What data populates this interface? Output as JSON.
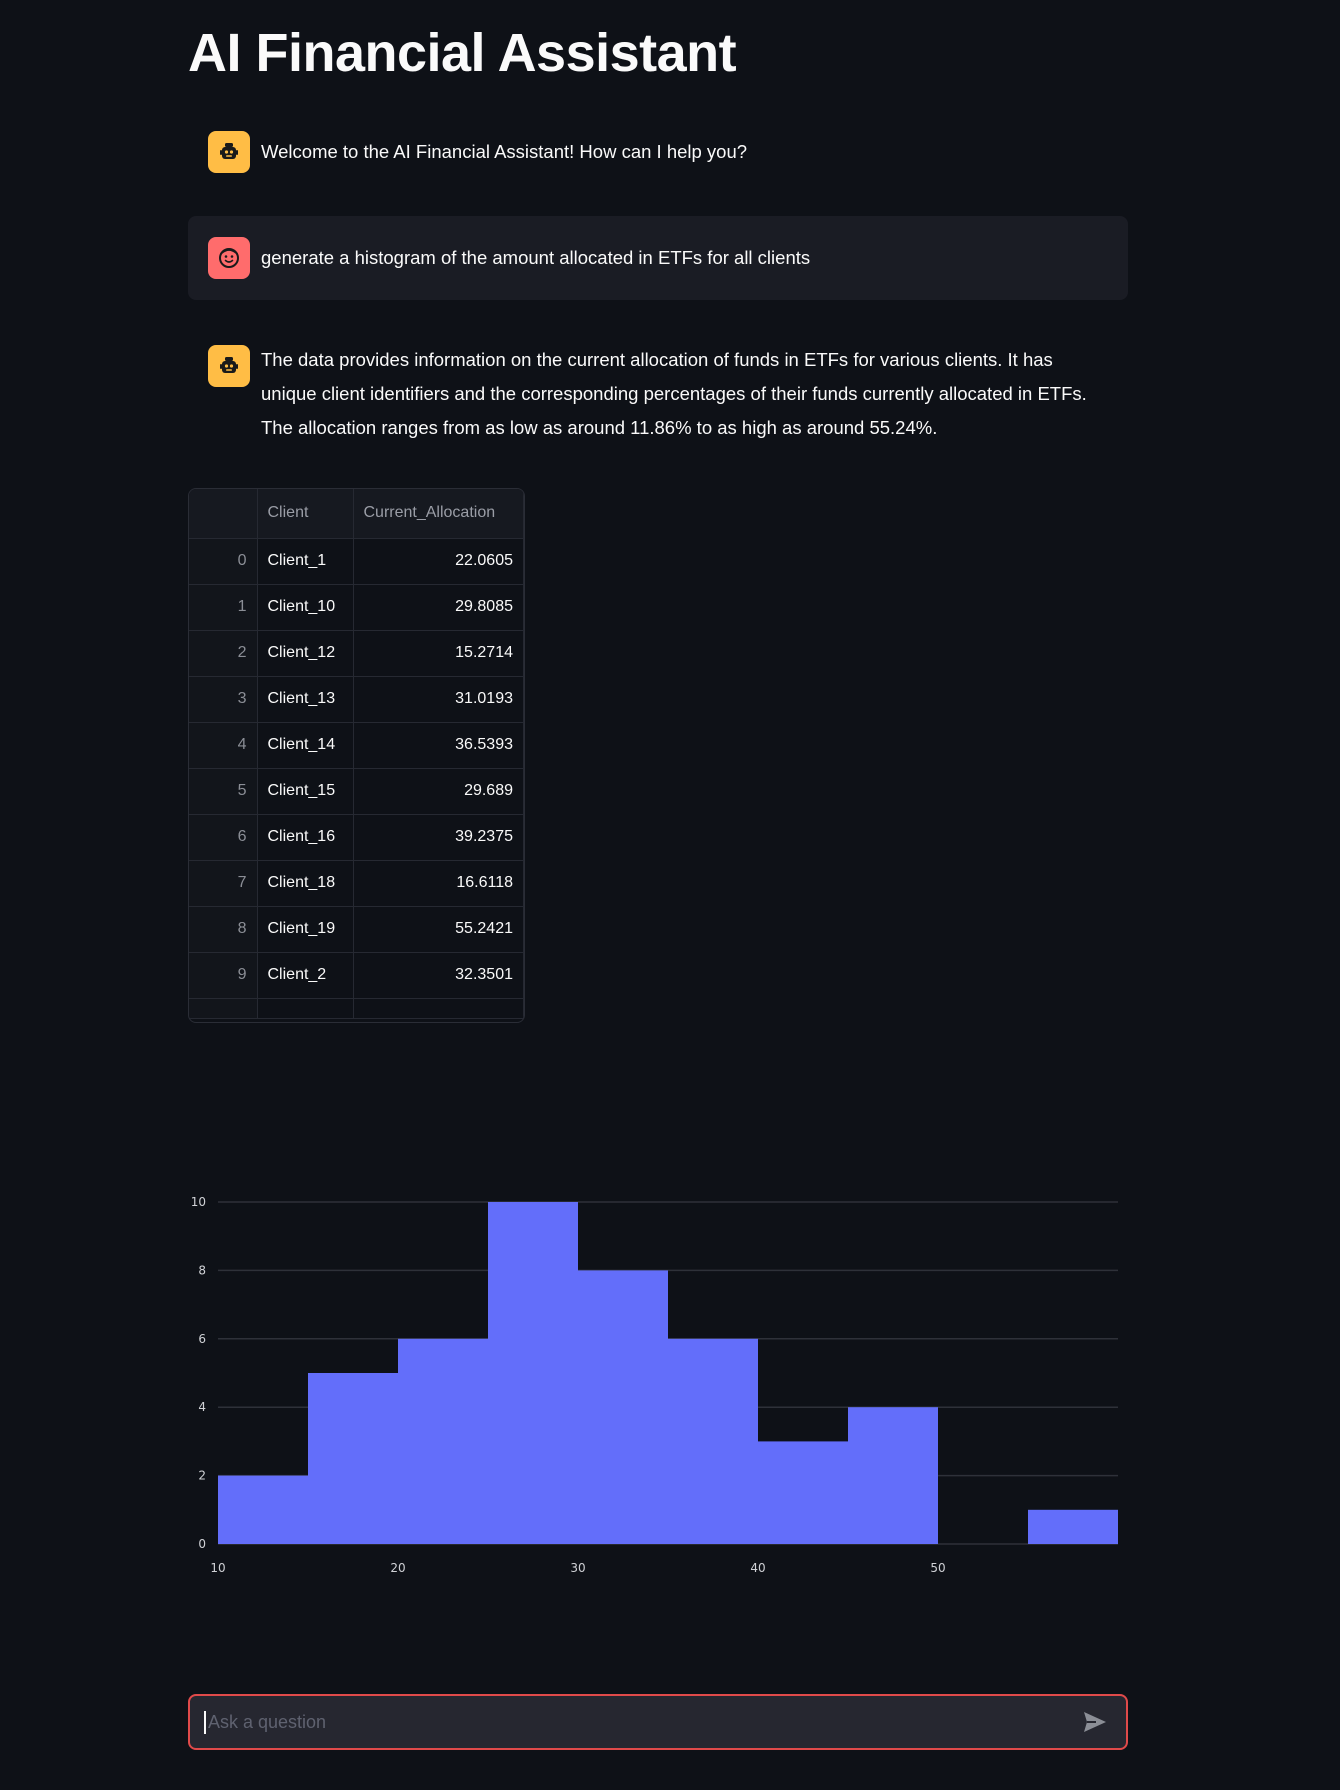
{
  "app": {
    "title": "AI Financial Assistant"
  },
  "messages": [
    {
      "role": "assistant",
      "avatar_icon": "robot-icon",
      "text": "Welcome to the AI Financial Assistant! How can I help you?"
    },
    {
      "role": "user",
      "avatar_icon": "smiley-face-icon",
      "text": "generate a histogram of the amount allocated in ETFs for all clients"
    },
    {
      "role": "assistant",
      "avatar_icon": "robot-icon",
      "text": "The data provides information on the current allocation of funds in ETFs for various clients. It has unique client identifiers and the corresponding percentages of their funds currently allocated in ETFs. The allocation ranges from as low as around 11.86% to as high as around 55.24%."
    }
  ],
  "dataframe": {
    "columns": [
      "",
      "Client",
      "Current_Allocation"
    ],
    "rows": [
      {
        "index": "0",
        "client": "Client_1",
        "allocation": "22.0605"
      },
      {
        "index": "1",
        "client": "Client_10",
        "allocation": "29.8085"
      },
      {
        "index": "2",
        "client": "Client_12",
        "allocation": "15.2714"
      },
      {
        "index": "3",
        "client": "Client_13",
        "allocation": "31.0193"
      },
      {
        "index": "4",
        "client": "Client_14",
        "allocation": "36.5393"
      },
      {
        "index": "5",
        "client": "Client_15",
        "allocation": "29.689"
      },
      {
        "index": "6",
        "client": "Client_16",
        "allocation": "39.2375"
      },
      {
        "index": "7",
        "client": "Client_18",
        "allocation": "16.6118"
      },
      {
        "index": "8",
        "client": "Client_19",
        "allocation": "55.2421"
      },
      {
        "index": "9",
        "client": "Client_2",
        "allocation": "32.3501"
      }
    ]
  },
  "chart_data": {
    "type": "bar",
    "bins": [
      {
        "x0": 10,
        "x1": 15,
        "count": 2
      },
      {
        "x0": 15,
        "x1": 20,
        "count": 5
      },
      {
        "x0": 20,
        "x1": 25,
        "count": 6
      },
      {
        "x0": 25,
        "x1": 30,
        "count": 10
      },
      {
        "x0": 30,
        "x1": 35,
        "count": 8
      },
      {
        "x0": 35,
        "x1": 40,
        "count": 6
      },
      {
        "x0": 40,
        "x1": 45,
        "count": 3
      },
      {
        "x0": 45,
        "x1": 50,
        "count": 4
      },
      {
        "x0": 50,
        "x1": 55,
        "count": 0
      },
      {
        "x0": 55,
        "x1": 60,
        "count": 1
      }
    ],
    "xlim": [
      10,
      60
    ],
    "ylim": [
      0,
      10
    ],
    "xticks": [
      10,
      20,
      30,
      40,
      50
    ],
    "yticks": [
      0,
      2,
      4,
      6,
      8,
      10
    ],
    "title": "",
    "xlabel": "",
    "ylabel": "",
    "grid": true,
    "bar_color": "#636efa",
    "grid_color": "#2e3139"
  },
  "chat_input": {
    "placeholder": "Ask a question",
    "value": ""
  },
  "colors": {
    "background": "#0e1117",
    "assistant_avatar": "#ffbd45",
    "user_avatar": "#ff6c6c",
    "input_border": "#e04a4a"
  }
}
